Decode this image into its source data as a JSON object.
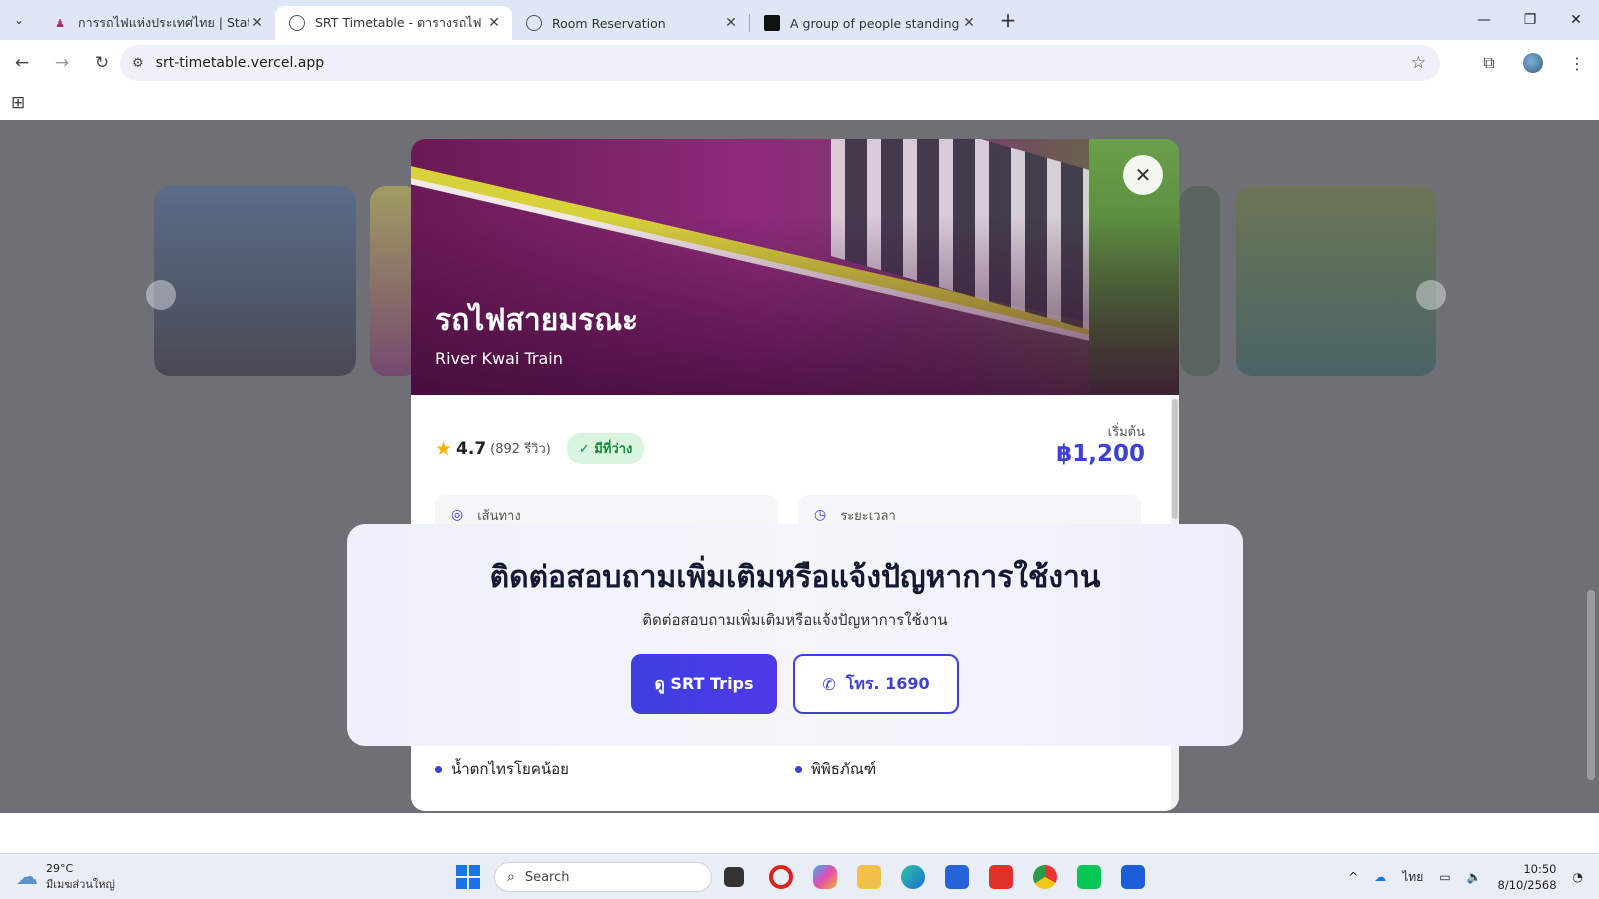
{
  "browser": {
    "tabs": [
      {
        "title": "การรถไฟแห่งประเทศไทย | State Rai",
        "active": false
      },
      {
        "title": "SRT Timetable - ตารางรถไฟ",
        "active": true
      },
      {
        "title": "Room Reservation",
        "active": false
      },
      {
        "title": "A group of people standing in f",
        "active": false
      }
    ],
    "url": "srt-timetable.vercel.app"
  },
  "trip": {
    "title_th": "รถไฟสายมรณะ",
    "title_en": "River Kwai Train",
    "rating": "4.7",
    "reviews": "(892 รีวิว)",
    "availability": "✓ มีที่ว่าง",
    "price_label": "เริ่มต้น",
    "price": "฿1,200",
    "info_route": "เส้นทาง",
    "info_duration": "ระยะเวลา",
    "spots": [
      "น้ำตกไทรโยคน้อย",
      "พิพิธภัณฑ์"
    ]
  },
  "contact": {
    "title": "ติดต่อสอบถามเพิ่มเติมหรือแจ้งปัญหาการใช้งาน",
    "subtitle": "ติดต่อสอบถามเพิ่มเติมหรือแจ้งปัญหาการใช้งาน",
    "primary_button": "ดู SRT Trips",
    "phone_button": "โทร. 1690"
  },
  "taskbar": {
    "temperature": "29°C",
    "weather_desc": "มีเมฆส่วนใหญ่",
    "search_placeholder": "Search",
    "language": "ไทย",
    "time": "10:50",
    "date": "8/10/2568"
  },
  "colors": {
    "accent": "#3d3fd6",
    "badge_bg": "#d9f5df",
    "badge_text": "#18893a"
  }
}
